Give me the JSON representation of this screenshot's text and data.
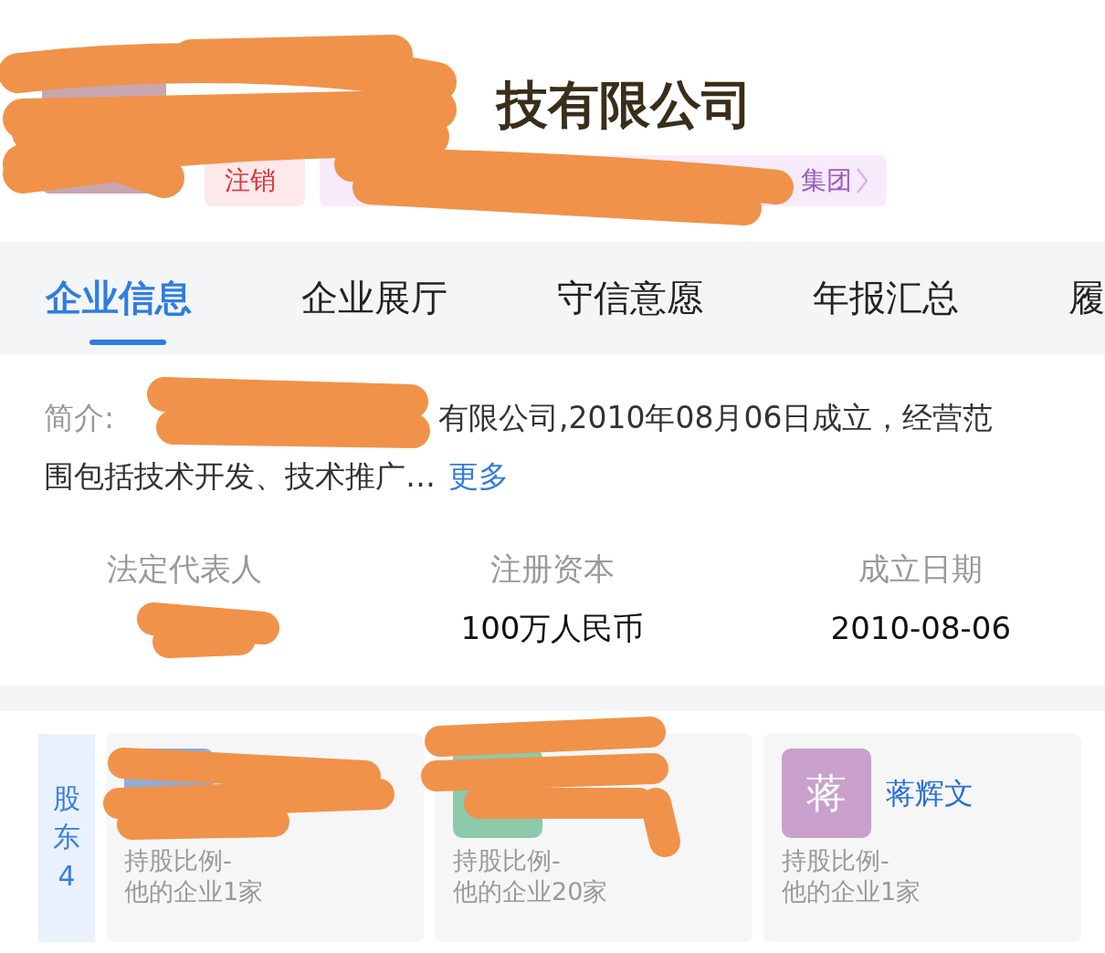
{
  "header": {
    "company_name": "技有限公司",
    "tags": [
      {
        "kind": "status",
        "label": "注销"
      },
      {
        "kind": "group",
        "label": "集团"
      }
    ]
  },
  "tabs": [
    {
      "label": "企业信息",
      "selected": true
    },
    {
      "label": "企业展厅",
      "selected": false
    },
    {
      "label": "守信意愿",
      "selected": false
    },
    {
      "label": "年报汇总",
      "selected": false
    },
    {
      "label": "履",
      "selected": false
    }
  ],
  "intro": {
    "label": "简介:",
    "lines": [
      "有限公司,2010年08月06日成立，经营范",
      "围包括技术开发、技术推广…"
    ],
    "more": "更多"
  },
  "facts": [
    {
      "label": "法定代表人"
    },
    {
      "label": "注册资本",
      "value": "100万人民币"
    },
    {
      "label": "成立日期",
      "value": "2010-08-06"
    }
  ],
  "shareholders": {
    "label": "股东",
    "count": "4",
    "items": [
      {
        "color": "#91acd6",
        "share": "持股比例-",
        "companies": "他的企业1家"
      },
      {
        "color": "#8ccaa9",
        "share": "持股比例-",
        "companies": "他的企业20家"
      },
      {
        "color": "#c9a0cc",
        "avatar_char": "蒋",
        "name": "蒋辉文",
        "share": "持股比例-",
        "companies": "他的企业1家"
      }
    ]
  },
  "redactions": [
    {
      "kind": "title"
    },
    {
      "kind": "group"
    },
    {
      "kind": "intro"
    },
    {
      "kind": "legal_rep"
    },
    {
      "kind": "shareholder_1"
    },
    {
      "kind": "shareholder_2"
    }
  ]
}
